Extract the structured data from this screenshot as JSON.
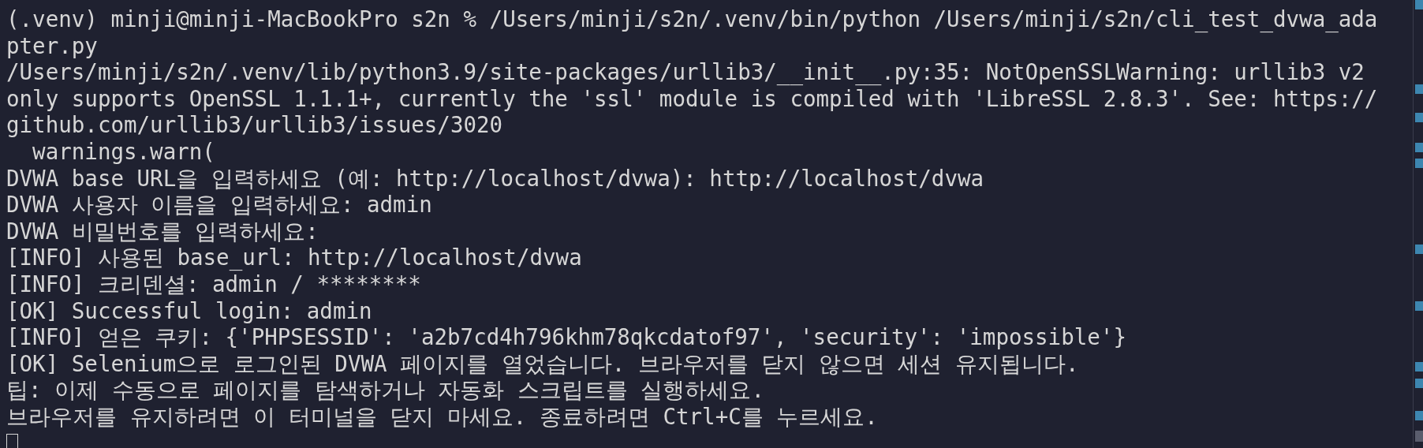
{
  "terminal": {
    "lines": [
      "(.venv) minji@minji-MacBookPro s2n % /Users/minji/s2n/.venv/bin/python /Users/minji/s2n/cli_test_dvwa_ada",
      "pter.py",
      "/Users/minji/s2n/.venv/lib/python3.9/site-packages/urllib3/__init__.py:35: NotOpenSSLWarning: urllib3 v2",
      "only supports OpenSSL 1.1.1+, currently the 'ssl' module is compiled with 'LibreSSL 2.8.3'. See: https://",
      "github.com/urllib3/urllib3/issues/3020",
      "  warnings.warn(",
      "DVWA base URL을 입력하세요 (예: http://localhost/dvwa): http://localhost/dvwa",
      "DVWA 사용자 이름을 입력하세요: admin",
      "DVWA 비밀번호를 입력하세요:",
      "[INFO] 사용된 base_url: http://localhost/dvwa",
      "[INFO] 크리덴셜: admin / ********",
      "[OK] Successful login: admin",
      "[INFO] 얻은 쿠키: {'PHPSESSID': 'a2b7cd4h796khm78qkcdatof97', 'security': 'impossible'}",
      "[OK] Selenium으로 로그인된 DVWA 페이지를 열었습니다. 브라우저를 닫지 않으면 세션 유지됩니다.",
      "팁: 이제 수동으로 페이지를 탐색하거나 자동화 스크립트를 실행하세요.",
      "브라우저를 유지하려면 이 터미널을 닫지 마세요. 종료하려면 Ctrl+C를 누르세요."
    ]
  }
}
